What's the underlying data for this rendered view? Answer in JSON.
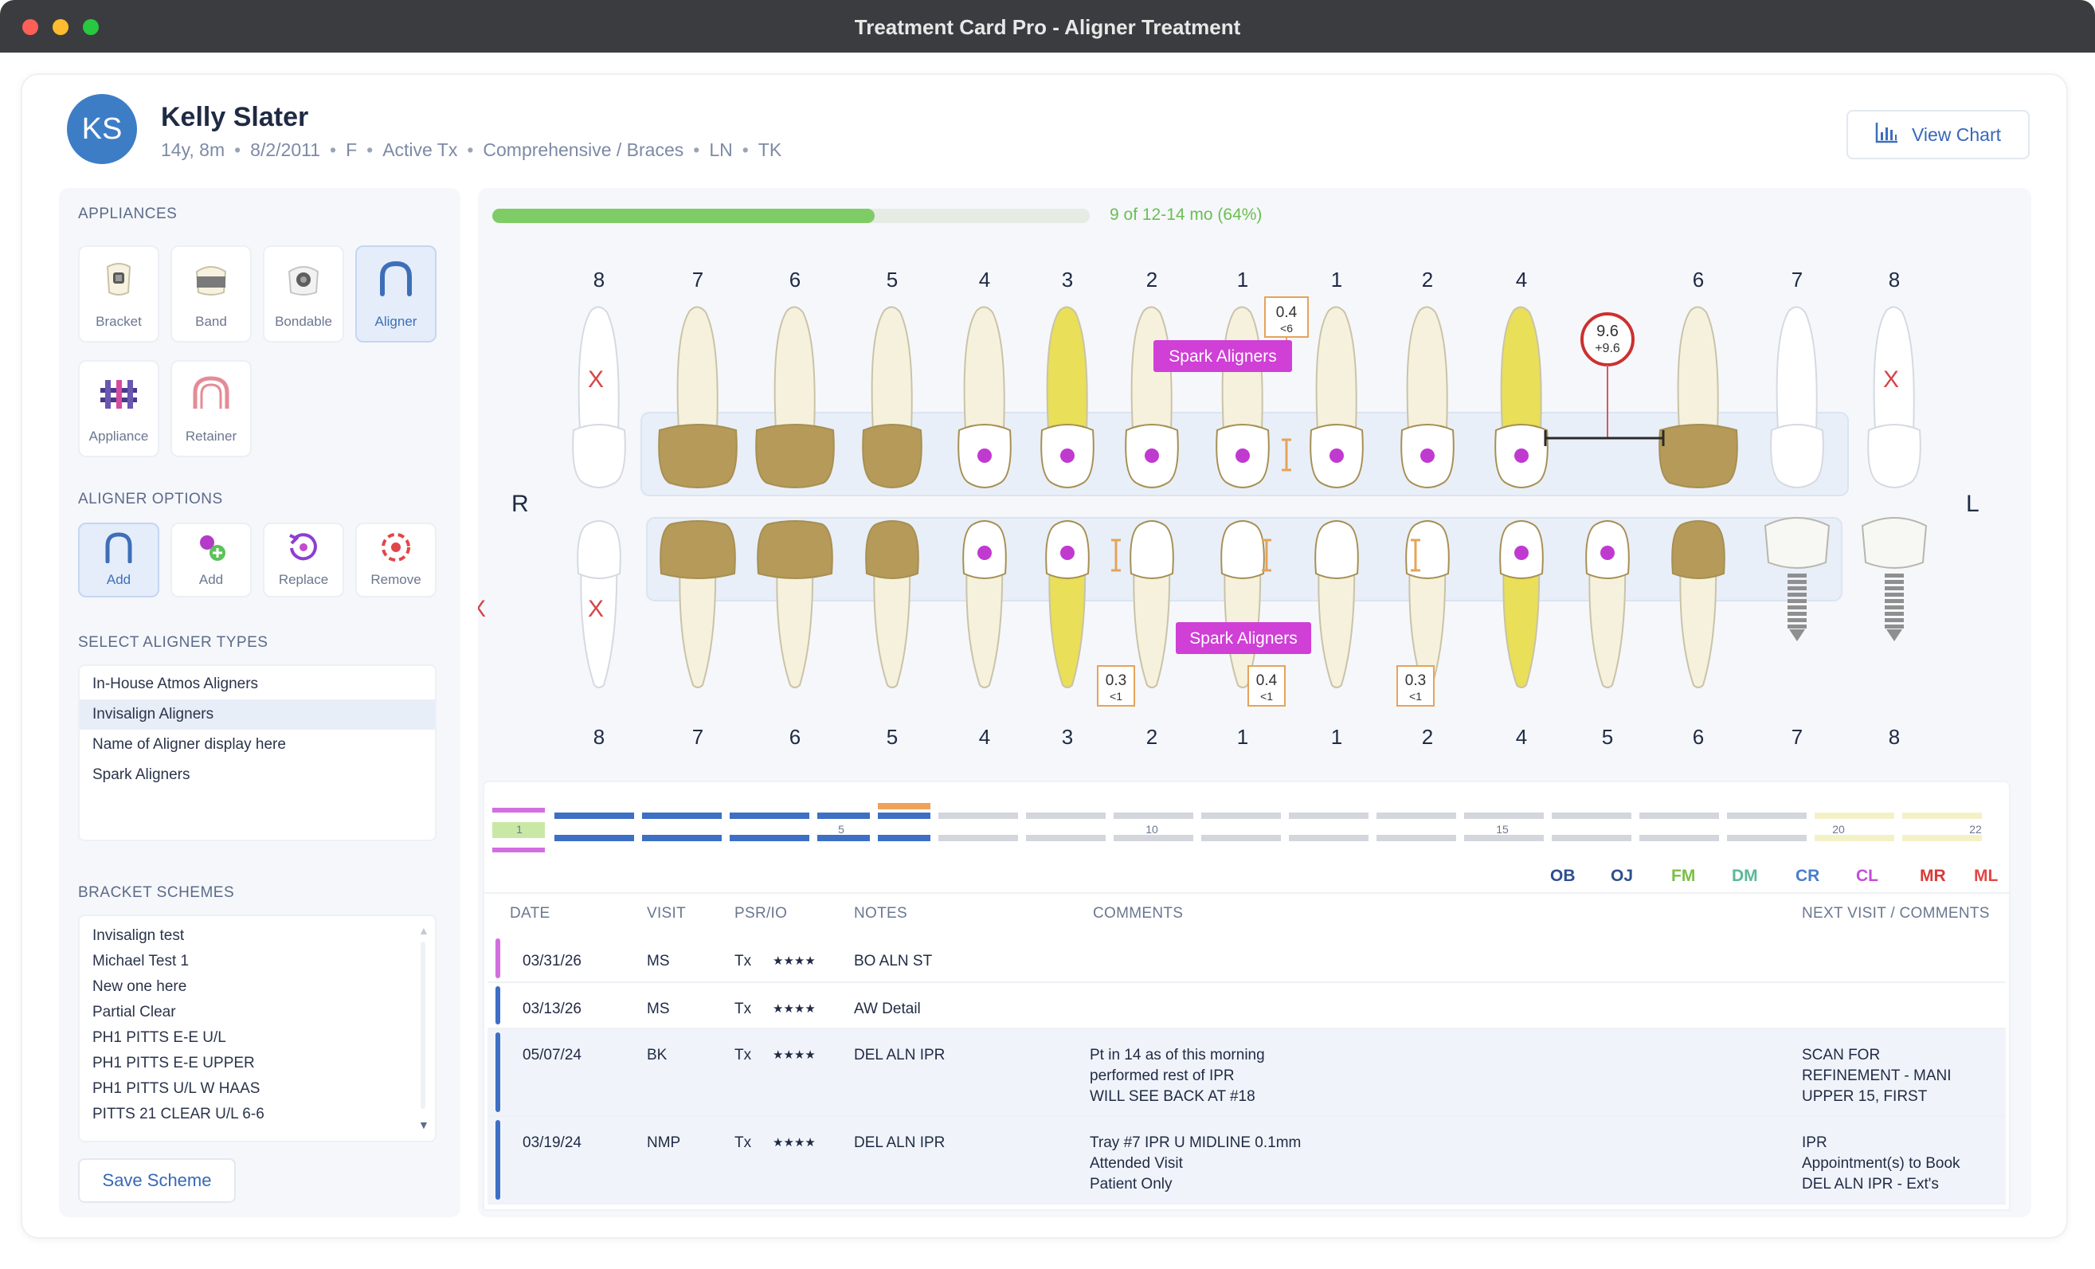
{
  "window": {
    "title": "Treatment Card Pro - Aligner Treatment"
  },
  "patient": {
    "initials": "KS",
    "name": "Kelly Slater",
    "age": "14y, 8m",
    "dob": "8/2/2011",
    "sex": "F",
    "status": "Active Tx",
    "treatment": "Comprehensive / Braces",
    "provider1": "LN",
    "provider2": "TK"
  },
  "header": {
    "view_chart": "View Chart"
  },
  "appliances": {
    "heading": "APPLIANCES",
    "items": [
      {
        "label": "Bracket",
        "icon": "bracket-icon"
      },
      {
        "label": "Band",
        "icon": "band-icon"
      },
      {
        "label": "Bondable",
        "icon": "bondable-icon"
      },
      {
        "label": "Aligner",
        "icon": "aligner-icon",
        "active": true
      },
      {
        "label": "Appliance",
        "icon": "appliance-icon"
      },
      {
        "label": "Retainer",
        "icon": "retainer-icon"
      }
    ]
  },
  "aligner_options": {
    "heading": "ALIGNER OPTIONS",
    "items": [
      {
        "label": "Add",
        "icon": "add-aligner-icon",
        "active": true
      },
      {
        "label": "Add",
        "icon": "add-attachment-icon"
      },
      {
        "label": "Replace",
        "icon": "replace-icon"
      },
      {
        "label": "Remove",
        "icon": "remove-icon"
      }
    ]
  },
  "aligner_types": {
    "heading": "SELECT ALIGNER TYPES",
    "items": [
      "In-House Atmos Aligners",
      "Invisalign Aligners",
      "Name of Aligner display here",
      "Spark Aligners"
    ],
    "selected": 1
  },
  "bracket_schemes": {
    "heading": "BRACKET SCHEMES",
    "items": [
      "Invisalign test",
      "Michael Test 1",
      "New one here",
      "Partial Clear",
      "PH1 PITTS E-E U/L",
      "PH1 PITTS E-E UPPER",
      "PH1 PITTS U/L W HAAS",
      "PITTS 21 CLEAR U/L 6-6"
    ],
    "save_label": "Save Scheme"
  },
  "progress": {
    "label": "9 of 12-14 mo (64%)",
    "fraction": 0.64
  },
  "tooth_chart": {
    "side_right": "R",
    "side_left": "L",
    "upper_numbers": [
      "8",
      "7",
      "6",
      "5",
      "4",
      "3",
      "2",
      "1",
      "1",
      "2",
      "4",
      "6",
      "7",
      "8"
    ],
    "lower_numbers": [
      "8",
      "7",
      "6",
      "5",
      "4",
      "3",
      "2",
      "1",
      "1",
      "2",
      "4",
      "5",
      "6",
      "7",
      "8"
    ],
    "upper_aligner_label": "Spark Aligners",
    "lower_aligner_label": "Spark Aligners",
    "upper_ipr": {
      "top": "0.4",
      "bottom": "<6"
    },
    "space": {
      "top": "9.6",
      "bottom": "+9.6"
    },
    "lower_ipr": [
      {
        "top": "0.3",
        "bottom": "<1"
      },
      {
        "top": "0.4",
        "bottom": "<1"
      },
      {
        "top": "0.3",
        "bottom": "<1"
      }
    ],
    "missing_mark": "X"
  },
  "timeline": {
    "markers": [
      "1",
      "5",
      "10",
      "15",
      "20",
      "22"
    ],
    "legend": [
      {
        "label": "OB",
        "color": "#2d4f8e"
      },
      {
        "label": "OJ",
        "color": "#2d4f8e"
      },
      {
        "label": "FM",
        "color": "#7bbf45"
      },
      {
        "label": "DM",
        "color": "#5bb89a"
      },
      {
        "label": "CR",
        "color": "#4a7dc9"
      },
      {
        "label": "CL",
        "color": "#c24ed8"
      },
      {
        "label": "MR",
        "color": "#d83a3a"
      },
      {
        "label": "ML",
        "color": "#e04848"
      }
    ]
  },
  "visits": {
    "columns": [
      "DATE",
      "VISIT",
      "PSR/IO",
      "NOTES",
      "COMMENTS",
      "NEXT VISIT / COMMENTS"
    ],
    "rows": [
      {
        "date": "03/31/26",
        "visit": "MS",
        "psr": "Tx",
        "stars": "★★★★",
        "notes": "BO ALN ST",
        "comments": [
          "",
          "",
          ""
        ],
        "next": [
          "",
          "",
          ""
        ],
        "color": "#d36ee0"
      },
      {
        "date": "03/13/26",
        "visit": "MS",
        "psr": "Tx",
        "stars": "★★★★",
        "notes": "AW Detail",
        "comments": [
          "",
          "",
          ""
        ],
        "next": [
          "",
          "",
          ""
        ],
        "color": "#3d6fc4"
      },
      {
        "date": "05/07/24",
        "visit": "BK",
        "psr": "Tx",
        "stars": "★★★★",
        "notes": "DEL ALN IPR",
        "comments": [
          "Pt in 14 as of this morning",
          "performed rest of IPR",
          "WILL SEE BACK AT #18"
        ],
        "next": [
          "SCAN FOR",
          "REFINEMENT - MANI",
          "UPPER 15, FIRST"
        ],
        "color": "#3d6fc4"
      },
      {
        "date": "03/19/24",
        "visit": "NMP",
        "psr": "Tx",
        "stars": "★★★★",
        "notes": "DEL ALN IPR",
        "comments": [
          "Tray #7 IPR U MIDLINE 0.1mm",
          "Attended Visit",
          "Patient Only"
        ],
        "next": [
          "IPR",
          "Appointment(s) to Book",
          "DEL ALN IPR - Ext's"
        ],
        "color": "#3d6fc4"
      }
    ]
  },
  "colors": {
    "accent": "#3d6fb8",
    "crown_gold": "#b59a5a",
    "enamel": "#f6f1dc",
    "highlight_yellow": "#e9df58",
    "attachment_purple": "#c03ad0",
    "aligner_label_bg": "#d03fd6",
    "progress_green": "#7fcc66"
  }
}
